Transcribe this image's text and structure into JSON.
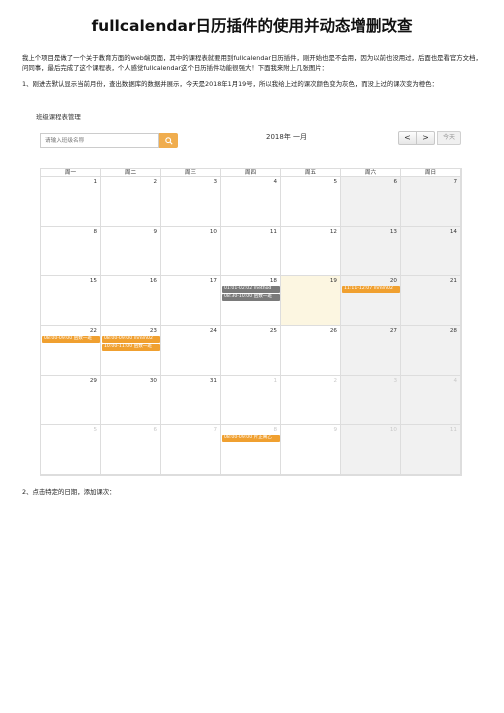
{
  "title": "fullcalendar日历插件的使用并动态增删改查",
  "intro": "我上个项目是做了一个关于教育方面的web端页面，其中的课程表就要用到fullcalendar日历插件，刚开始也是不会用，因为以前也没用过，后面也是看官方文档，问同事，最后完成了这个课程表，个人感觉fullcalendar这个日历插件功能很强大！下面我来附上几张图片：",
  "point1": "1、刚进去默认显示当前月份，查出数据库的数据并展示，今天是2018年1月19号，所以我给上过的课次颜色变为灰色，而没上过的课次变为橙色：",
  "panel_title": "班级课程表管理",
  "search": {
    "placeholder": "请输入班级名称"
  },
  "calendar": {
    "title": "2018年 一月",
    "prev": "<",
    "next": ">",
    "today": "今天",
    "weekdays": [
      "周一",
      "周二",
      "周三",
      "周四",
      "周五",
      "周六",
      "周日"
    ],
    "weeks": [
      [
        "1",
        "2",
        "3",
        "4",
        "5",
        "6",
        "7"
      ],
      [
        "8",
        "9",
        "10",
        "11",
        "12",
        "13",
        "14"
      ],
      [
        "15",
        "16",
        "17",
        "18",
        "19",
        "20",
        "21"
      ],
      [
        "22",
        "23",
        "24",
        "25",
        "26",
        "27",
        "28"
      ],
      [
        "29",
        "30",
        "31",
        "1",
        "2",
        "3",
        "4"
      ],
      [
        "5",
        "6",
        "7",
        "8",
        "9",
        "10",
        "11"
      ]
    ],
    "events": [
      {
        "week": 2,
        "day": 3,
        "slot": 0,
        "text": "01:01-02:02 method",
        "status": "past"
      },
      {
        "week": 2,
        "day": 3,
        "slot": 1,
        "text": "08:30-10:00 函数一班",
        "status": "past"
      },
      {
        "week": 2,
        "day": 5,
        "slot": 0,
        "text": "11:11-12:07 mmm02",
        "status": "future"
      },
      {
        "week": 3,
        "day": 0,
        "slot": 0,
        "text": "08:00-09:00 函数一班",
        "status": "future"
      },
      {
        "week": 3,
        "day": 1,
        "slot": 0,
        "text": "08:00-09:00 mmm02",
        "status": "future"
      },
      {
        "week": 3,
        "day": 1,
        "slot": 1,
        "text": "10:00-11:00 函数一班",
        "status": "future"
      },
      {
        "week": 5,
        "day": 3,
        "slot": 0,
        "text": "08:00-09:00 片正阐乙",
        "status": "future"
      }
    ]
  },
  "point2": "2、点击特定的日期，添加课次："
}
